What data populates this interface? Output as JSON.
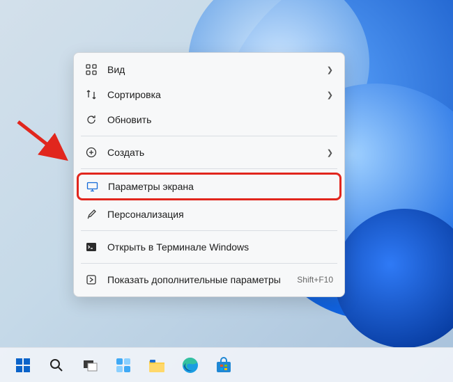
{
  "context_menu": {
    "items": [
      {
        "label": "Вид",
        "has_submenu": true,
        "icon": "grid"
      },
      {
        "label": "Сортировка",
        "has_submenu": true,
        "icon": "sort"
      },
      {
        "label": "Обновить",
        "has_submenu": false,
        "icon": "refresh"
      },
      {
        "label": "Создать",
        "has_submenu": true,
        "icon": "plus-circle",
        "sep_before": true
      },
      {
        "label": "Параметры экрана",
        "has_submenu": false,
        "icon": "display",
        "highlighted": true,
        "sep_before": true
      },
      {
        "label": "Персонализация",
        "has_submenu": false,
        "icon": "brush"
      },
      {
        "label": "Открыть в Терминале Windows",
        "has_submenu": false,
        "icon": "terminal",
        "sep_before": true
      },
      {
        "label": "Показать дополнительные параметры",
        "has_submenu": false,
        "icon": "more-options",
        "shortcut": "Shift+F10",
        "sep_before": true
      }
    ]
  },
  "taskbar": {
    "items": [
      {
        "name": "start",
        "icon": "windows"
      },
      {
        "name": "search",
        "icon": "search"
      },
      {
        "name": "task-view",
        "icon": "taskview"
      },
      {
        "name": "widgets",
        "icon": "widgets"
      },
      {
        "name": "file-explorer",
        "icon": "explorer"
      },
      {
        "name": "edge",
        "icon": "edge"
      },
      {
        "name": "microsoft-store",
        "icon": "store"
      }
    ]
  },
  "annotation": {
    "arrow_color": "#e1261d",
    "highlight_color": "#e1261d"
  }
}
